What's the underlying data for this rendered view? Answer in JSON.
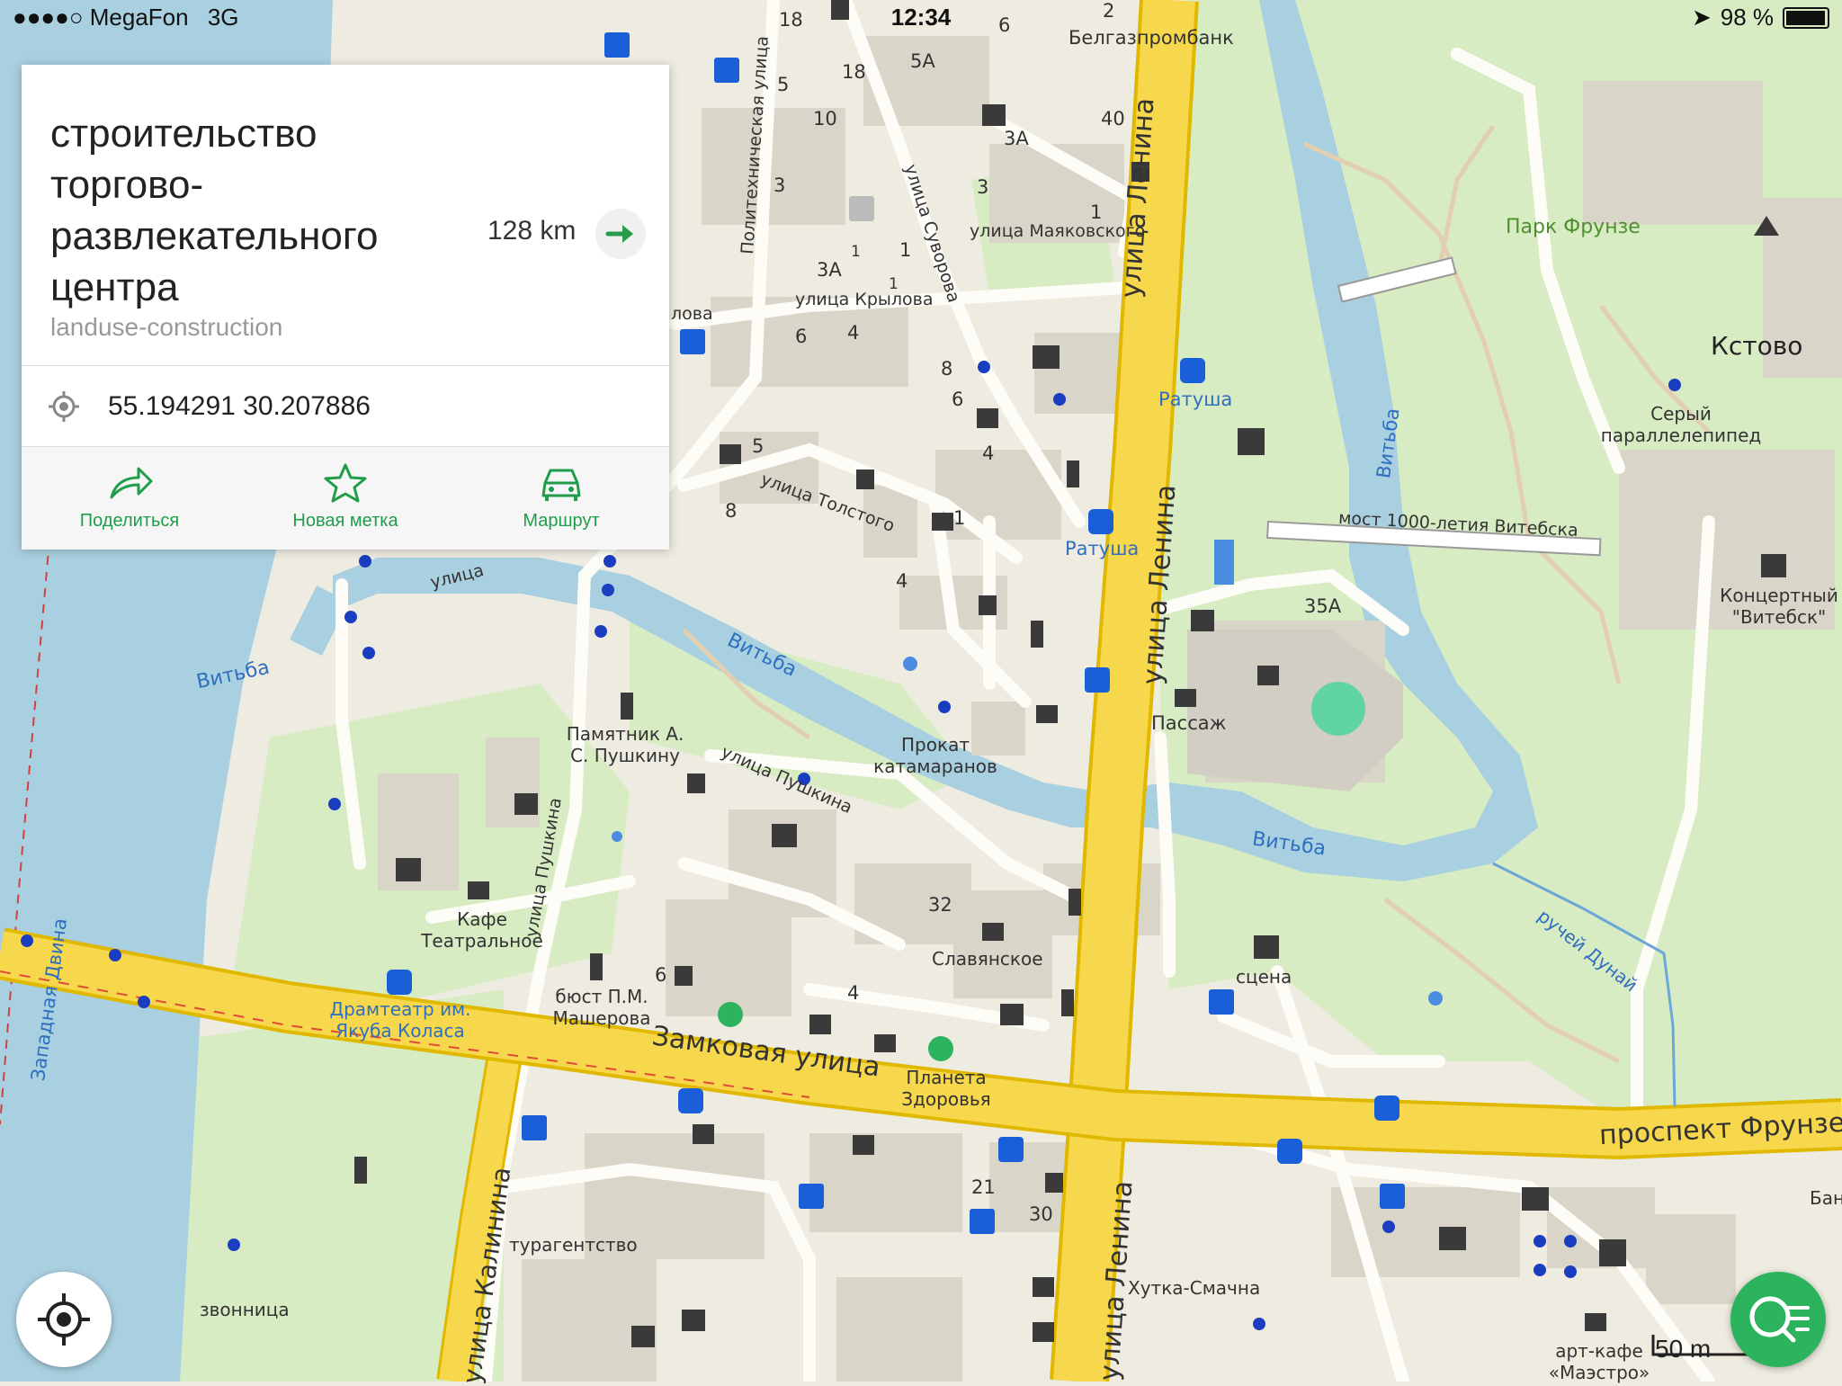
{
  "status_bar": {
    "carrier": "MegaFon",
    "network": "3G",
    "time": "12:34",
    "battery_percent": "98 %",
    "battery_level": 0.98
  },
  "place_card": {
    "title": "строительство торгово-развлекательного центра",
    "subtitle": "landuse-construction",
    "distance": "128 km",
    "coordinates": "55.194291 30.207886",
    "actions": {
      "share": "Поделиться",
      "bookmark": "Новая метка",
      "route": "Маршрут"
    }
  },
  "scale_label": "50 m",
  "colors": {
    "road_primary": "#f7d74b",
    "road_primary_border": "#e1b800",
    "water": "#a9d0e0",
    "park": "#d8ecc4",
    "accent": "#2bb45d",
    "poi": "#3a3a3a",
    "blue_label": "#2f6fbf"
  },
  "map_labels": {
    "belgazprombank": "Белгазпромбанк",
    "ul_lenina_1": "улица Ленина",
    "ul_lenina_2": "улица Ленина",
    "ul_lenina_3": "улица Ленина",
    "park_frunze": "Парк Фрунзе",
    "kstovo": "Кстово",
    "politekh": "Политехническая улица",
    "suvorova": "улица Суворова",
    "mayakovskogo": "улица Маяковского",
    "krylova": "улица Крылова",
    "ratusha_1": "Ратуша",
    "ratusha_2": "Ратуша",
    "seryi": "Серый параллелепипед",
    "most": "мост 1000-летия Витебска",
    "vitba_1": "Витьба",
    "vitba_2": "Витьба",
    "vitba_3": "Витьба",
    "vitba_4": "Витьба",
    "tolstogo": "улица Толстого",
    "koncert": "Концертный \"Витебск\"",
    "passazh": "Пассаж",
    "prokat": "Прокат катамаранов",
    "pamyatnik": "Памятник А. С. Пушкину",
    "pushkina": "улица Пушкина",
    "pushkina_2": "улица Пушкина",
    "kafe_teatr": "Кафе Театральное",
    "slavyanskoe": "Славянское",
    "scena": "сцена",
    "dramteatr": "Драмтеатр им. Якуба Коласа",
    "byust": "бюст П.М. Машерова",
    "zapad_dvina": "Западная Двина",
    "zamkovaya": "Замковая улица",
    "planeta": "Планета Здоровья",
    "prospekt": "проспект Фрунзе",
    "ruchei": "ручей Дунай",
    "kalinina": "улица Калинина",
    "turagentstvo": "турагентство",
    "zvonnica": "звонница",
    "khutka": "Хутка-Смачна",
    "art_kafe": "арт-кафе «Маэстро»",
    "ban": "Бан",
    "lova": "лова",
    "ulica_s": "улица"
  },
  "house_numbers": [
    "18",
    "6",
    "2",
    "5А",
    "5",
    "18",
    "10",
    "40",
    "3А",
    "3",
    "3",
    "1",
    "1",
    "3А",
    "1",
    "1",
    "6",
    "4",
    "8",
    "6",
    "4",
    "5",
    "8",
    "1",
    "4",
    "35А",
    "32",
    "6",
    "4",
    "21",
    "30"
  ]
}
